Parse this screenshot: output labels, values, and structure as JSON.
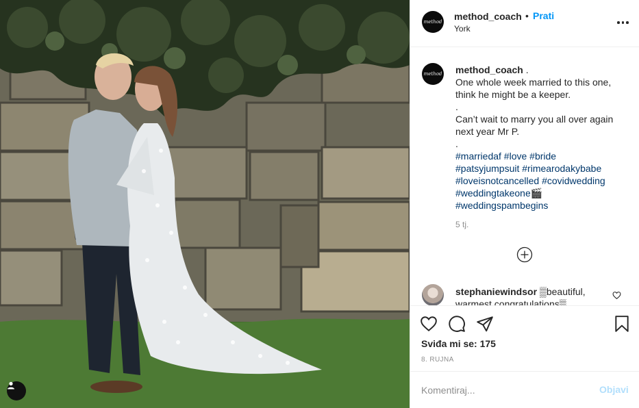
{
  "post": {
    "username": "method_coach",
    "follow_separator": "•",
    "follow_label": "Prati",
    "location": "York",
    "avatar_text": "method"
  },
  "caption": {
    "username": "method_coach",
    "username_suffix": " .",
    "lines": [
      "One whole week married to this one,",
      "think he might be a keeper.",
      ".",
      "Can’t wait to marry you all over again",
      "next year Mr P.",
      "."
    ],
    "hashtag_lines": [
      "#marriedaf #love #bride",
      "#patsyjumpsuit #rimearodakybabe",
      "#loveisnotcancelled #covidwedding",
      "#weddingtakeone🎬",
      "#weddingspambegins"
    ],
    "time": "5 tj."
  },
  "comment": {
    "username": "stephaniewindsor",
    "text": " ▒beautiful, warmest congratulations▒"
  },
  "actions": {
    "likes": "Sviđa mi se: 175",
    "date": "8. RUJNA"
  },
  "add_comment": {
    "placeholder": "Komentiraj...",
    "post_label": "Objavi"
  },
  "colors": {
    "accent": "#0095f6",
    "hashtag": "#00376b",
    "muted": "#8e8e8e",
    "post_disabled": "#b2dffc"
  },
  "icons": [
    "user-tag-icon",
    "more-options-icon",
    "load-more-icon",
    "like-icon",
    "comment-icon",
    "share-icon",
    "save-icon",
    "comment-like-icon"
  ]
}
